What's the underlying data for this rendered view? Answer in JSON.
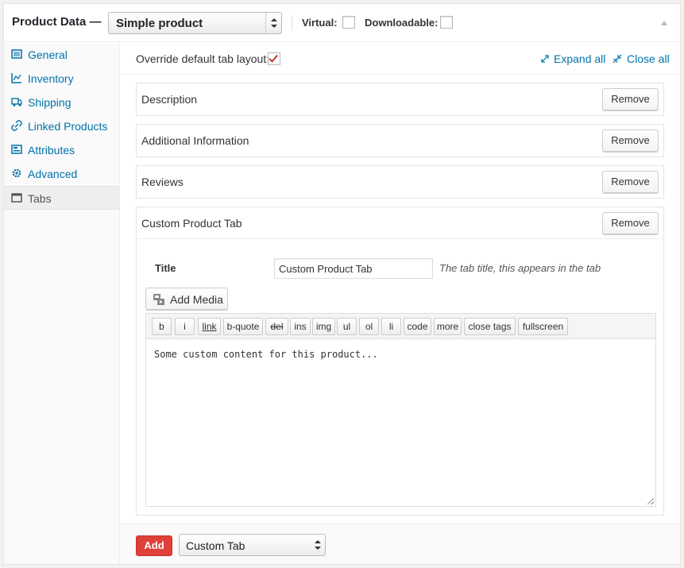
{
  "header": {
    "title": "Product Data —",
    "product_type": "Simple product",
    "virtual_label": "Virtual:",
    "downloadable_label": "Downloadable:"
  },
  "sidebar": {
    "items": [
      {
        "label": "General",
        "icon": "general-icon"
      },
      {
        "label": "Inventory",
        "icon": "inventory-icon"
      },
      {
        "label": "Shipping",
        "icon": "truck-icon"
      },
      {
        "label": "Linked Products",
        "icon": "link-icon"
      },
      {
        "label": "Attributes",
        "icon": "attributes-icon"
      },
      {
        "label": "Advanced",
        "icon": "gear-icon"
      },
      {
        "label": "Tabs",
        "icon": "window-icon",
        "active": true
      }
    ]
  },
  "main": {
    "override_label": "Override default tab layout:",
    "override_checked": true,
    "expand_all": "Expand all",
    "close_all": "Close all",
    "remove_label": "Remove",
    "tabs": [
      {
        "name": "Description"
      },
      {
        "name": "Additional Information"
      },
      {
        "name": "Reviews"
      },
      {
        "name": "Custom Product Tab"
      }
    ],
    "custom": {
      "title_label": "Title",
      "title_value": "Custom Product Tab",
      "title_desc": "The tab title, this appears in the tab",
      "add_media": "Add Media",
      "quicktags": [
        "b",
        "i",
        "link",
        "b-quote",
        "del",
        "ins",
        "img",
        "ul",
        "ol",
        "li",
        "code",
        "more",
        "close tags",
        "fullscreen"
      ],
      "content": "Some custom content for this product..."
    }
  },
  "footer": {
    "add_label": "Add",
    "tab_type": "Custom Tab"
  },
  "colors": {
    "link": "#0073aa",
    "add_button": "#e0403a",
    "check": "#c0392b"
  }
}
